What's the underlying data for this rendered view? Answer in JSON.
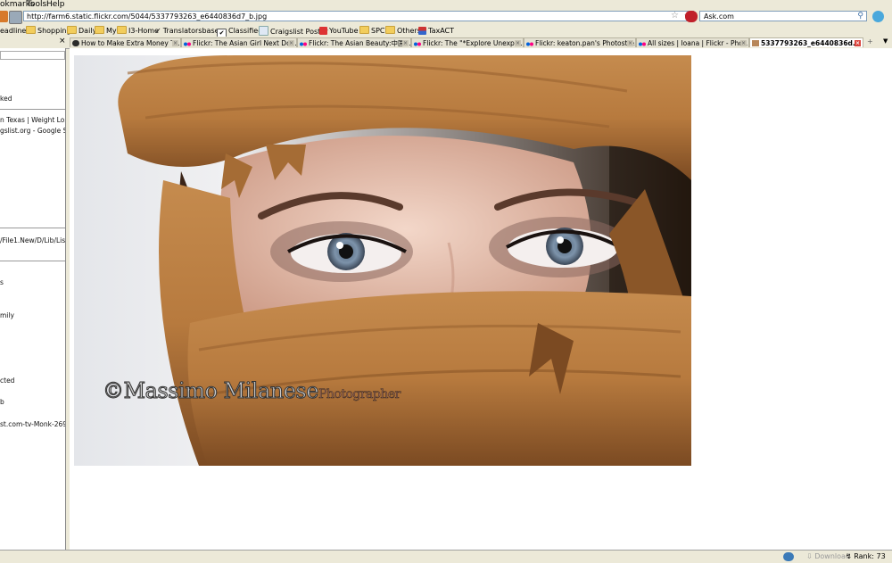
{
  "menu": [
    "okmarks",
    "Tools",
    "Help"
  ],
  "url": "http://farm6.static.flickr.com/5044/5337793263_e6440836d7_b.jpg",
  "search_engine": "Ask.com",
  "bookmarks": [
    {
      "label": "eadlines",
      "kind": "folder"
    },
    {
      "label": "Shopping",
      "kind": "folder"
    },
    {
      "label": "Daily",
      "kind": "folder"
    },
    {
      "label": "My",
      "kind": "folder"
    },
    {
      "label": "I3-Home",
      "kind": "folder"
    },
    {
      "label": "Translatorsbase",
      "kind": "check"
    },
    {
      "label": "Classifieds",
      "kind": "checkbox"
    },
    {
      "label": "Craigslist Poster",
      "kind": "page"
    },
    {
      "label": "YouTube",
      "kind": "youtube"
    },
    {
      "label": "SPC",
      "kind": "folder"
    },
    {
      "label": "Others",
      "kind": "folder"
    },
    {
      "label": "TaxACT",
      "kind": "flag"
    }
  ],
  "tabs": [
    {
      "label": "How to Make Extra Money Te...",
      "icon": "globe"
    },
    {
      "label": "Flickr: The Asian Girl Next Do...",
      "icon": "flickr"
    },
    {
      "label": "Flickr: The Asian Beauty:中国...",
      "icon": "flickr"
    },
    {
      "label": "Flickr: The \"*Explore Unexplo...",
      "icon": "flickr"
    },
    {
      "label": "Flickr: keaton.pan's Photostre...",
      "icon": "flickr"
    },
    {
      "label": "All sizes | Ioana | Flickr - Phot...",
      "icon": "flickr"
    },
    {
      "label": "5337793263_e6440836d...",
      "icon": "image",
      "active": true
    }
  ],
  "sidebar_items": [
    "ked",
    "n Texas | Weight Lo...",
    "gslist.org - Google S...",
    "/File1.New/D/Lib/Lis...",
    "s",
    "mily",
    "cted",
    "b",
    "st.com-tv-Monk-269..."
  ],
  "watermark": {
    "main": "©Massimo Milanese",
    "sub": "Photographer"
  },
  "status": {
    "download": "Download",
    "rank": "Rank: 73"
  },
  "colors": {
    "scarf": "#c58b4e",
    "eyes": "#7d93aa",
    "chrome": "#ece9d8"
  }
}
